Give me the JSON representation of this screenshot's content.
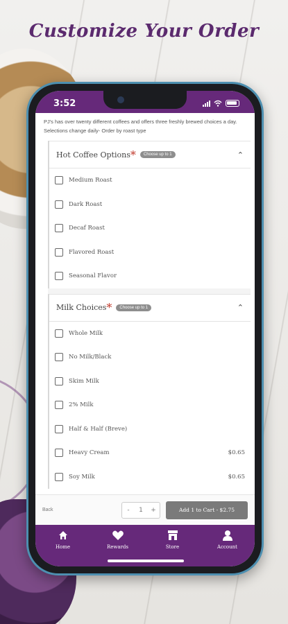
{
  "headline": "Customize Your Order",
  "status": {
    "time": "3:52"
  },
  "intro": "PJ's has over twenty different coffees and offers three freshly brewed choices a day. Selections change daily- Order by roast type",
  "sections": [
    {
      "title": "Hot Coffee Options",
      "required": "*",
      "pill": "Choose up to 1",
      "options": [
        {
          "label": "Medium Roast",
          "price": ""
        },
        {
          "label": "Dark Roast",
          "price": ""
        },
        {
          "label": "Decaf Roast",
          "price": ""
        },
        {
          "label": "Flavored Roast",
          "price": ""
        },
        {
          "label": "Seasonal Flavor",
          "price": ""
        }
      ]
    },
    {
      "title": "Milk Choices",
      "required": "*",
      "pill": "Choose up to 1",
      "options": [
        {
          "label": "Whole Milk",
          "price": ""
        },
        {
          "label": "No Milk/Black",
          "price": ""
        },
        {
          "label": "Skim Milk",
          "price": ""
        },
        {
          "label": "2% Milk",
          "price": ""
        },
        {
          "label": "Half & Half (Breve)",
          "price": ""
        },
        {
          "label": "Heavy Cream",
          "price": "$0.65"
        },
        {
          "label": "Soy Milk",
          "price": "$0.65"
        }
      ]
    }
  ],
  "footer": {
    "back": "Back",
    "minus": "-",
    "qty": "1",
    "plus": "+",
    "add_to_cart": "Add 1 to Cart - $2.75"
  },
  "tabs": [
    {
      "label": "Home",
      "icon": "home-icon"
    },
    {
      "label": "Rewards",
      "icon": "heart-icon"
    },
    {
      "label": "Store",
      "icon": "store-icon"
    },
    {
      "label": "Account",
      "icon": "person-icon"
    }
  ],
  "colors": {
    "brand": "#66297a",
    "button": "#7a7a7a"
  }
}
